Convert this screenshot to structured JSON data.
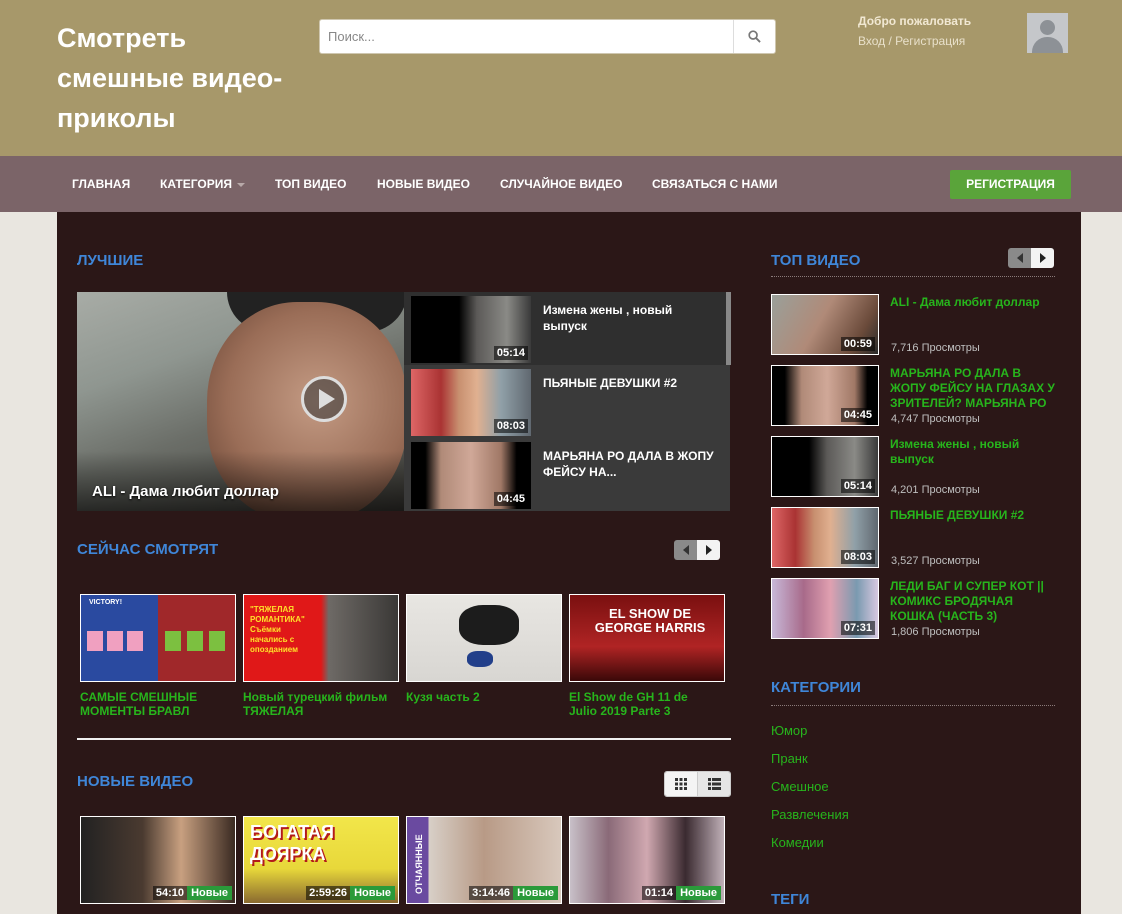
{
  "header": {
    "site_title": "Смотреть смешные видео-приколы",
    "search_placeholder": "Поиск...",
    "welcome": "Добро пожаловать",
    "login_register": "Вход / Регистрация"
  },
  "nav": {
    "items": [
      "ГЛАВНАЯ",
      "КАТЕГОРИЯ",
      "ТОП ВИДЕО",
      "НОВЫЕ ВИДЕО",
      "СЛУЧАЙНОЕ ВИДЕО",
      "СВЯЗАТЬСЯ С НАМИ"
    ],
    "register_button": "РЕГИСТРАЦИЯ"
  },
  "best": {
    "title": "ЛУЧШИЕ",
    "featured_title": "ALI - Дама любит доллар",
    "list": [
      {
        "title": "Измена жены , новый выпуск",
        "duration": "05:14"
      },
      {
        "title": "ПЬЯНЫЕ ДЕВУШКИ #2",
        "duration": "08:03"
      },
      {
        "title": "МАРЬЯНА РО ДАЛА В ЖОПУ ФЕЙСУ НА...",
        "duration": "04:45"
      }
    ]
  },
  "watching": {
    "title": "СЕЙЧАС СМОТРЯТ",
    "items": [
      {
        "title": "САМЫЕ СМЕШНЫЕ МОМЕНТЫ БРАВЛ",
        "overlay": "VICTORY!"
      },
      {
        "title": "Новый турецкий фильм ТЯЖЕЛАЯ",
        "overlay": "\"ТЯЖЕЛАЯ РОМАНТИКА\" Съёмки начались с опозданием"
      },
      {
        "title": "Кузя часть 2",
        "overlay": ""
      },
      {
        "title": "El Show de GH 11 de Julio 2019 Parte 3",
        "overlay": "EL SHOW DE GEORGE HARRIS"
      }
    ]
  },
  "new_videos": {
    "title": "НОВЫЕ ВИДЕО",
    "new_badge": "Новые",
    "items": [
      {
        "duration": "54:10",
        "overlay": ""
      },
      {
        "duration": "2:59:26",
        "overlay": "БОГАТАЯ ДОЯРКА"
      },
      {
        "duration": "3:14:46",
        "overlay": "ОТЧАЯННЫЕ"
      },
      {
        "duration": "01:14",
        "overlay": ""
      }
    ]
  },
  "sidebar": {
    "top_title": "ТОП ВИДЕО",
    "top_videos": [
      {
        "title": "ALI - Дама любит доллар",
        "duration": "00:59",
        "views": "7,716 Просмотры"
      },
      {
        "title": "МАРЬЯНА РО ДАЛА В ЖОПУ ФЕЙСУ НА ГЛАЗАХ У ЗРИТЕЛЕЙ? МАРЬЯНА РО",
        "duration": "04:45",
        "views": "4,747 Просмотры"
      },
      {
        "title": "Измена жены , новый выпуск",
        "duration": "05:14",
        "views": "4,201 Просмотры"
      },
      {
        "title": "ПЬЯНЫЕ ДЕВУШКИ #2",
        "duration": "08:03",
        "views": "3,527 Просмотры"
      },
      {
        "title": "ЛЕДИ БАГ И СУПЕР КОТ || КОМИКС БРОДЯЧАЯ КОШКА (ЧАСТЬ 3)",
        "duration": "07:31",
        "views": "1,806 Просмотры"
      }
    ],
    "categories_title": "КАТЕГОРИИ",
    "categories": [
      "Юмор",
      "Пранк",
      "Смешное",
      "Развлечения",
      "Комедии"
    ],
    "tags_title": "ТЕГИ"
  },
  "colors": {
    "header_bg": "#a7986a",
    "nav_bg": "#7b6468",
    "main_bg": "#2b1717",
    "accent_blue": "#3f86d8",
    "link_green": "#27b51c",
    "register_green": "#5aa43a"
  }
}
